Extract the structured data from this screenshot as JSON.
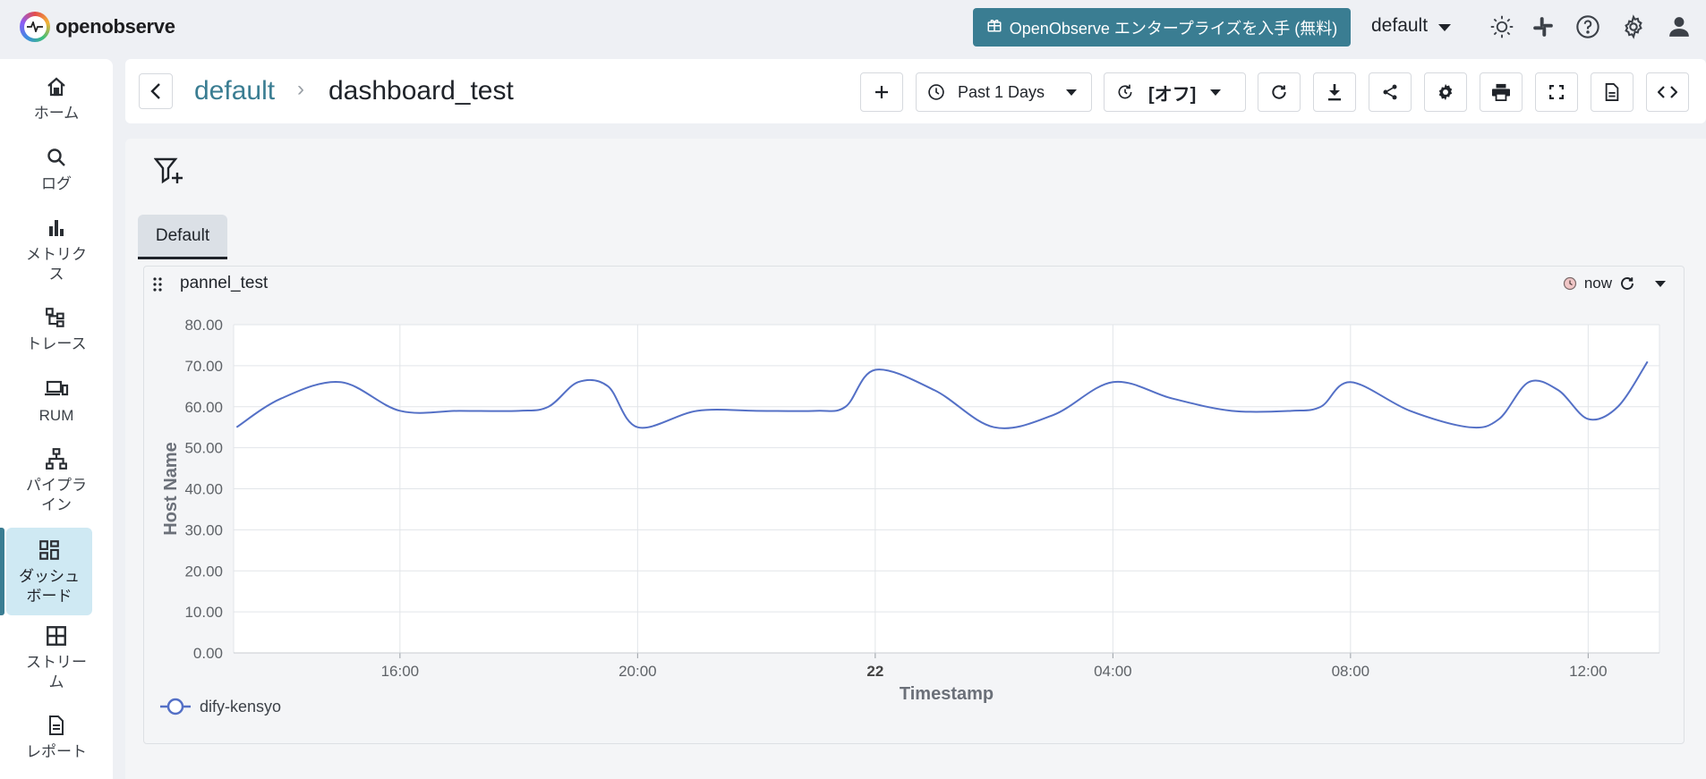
{
  "app": {
    "logo_text": "openobserve",
    "enterprise_button": "OpenObserve エンタープライズを入手 (無料)",
    "org_selected": "default"
  },
  "sidebar": {
    "items": [
      {
        "label": "ホーム",
        "icon": "home-icon"
      },
      {
        "label": "ログ",
        "icon": "search-icon"
      },
      {
        "label": "メトリクス",
        "icon": "bar-chart-icon"
      },
      {
        "label": "トレース",
        "icon": "trace-icon"
      },
      {
        "label": "RUM",
        "icon": "devices-icon"
      },
      {
        "label": "パイプライン",
        "icon": "pipeline-icon"
      },
      {
        "label": "ダッシュボード",
        "icon": "dashboard-icon",
        "active": true
      },
      {
        "label": "ストリーム",
        "icon": "grid-icon"
      },
      {
        "label": "レポート",
        "icon": "report-icon"
      }
    ]
  },
  "header": {
    "breadcrumb_root": "default",
    "breadcrumb_sep": "›",
    "title": "dashboard_test",
    "time_range": "Past 1 Days",
    "refresh_interval": "[オフ]"
  },
  "content": {
    "tab_label": "Default",
    "panel": {
      "title": "pannel_test",
      "time_label": "now"
    }
  },
  "colors": {
    "accent": "#3a7d92",
    "series": "#5470c6",
    "active_nav_bg": "#cfe9f3"
  },
  "chart_data": {
    "type": "line",
    "title": "pannel_test",
    "xlabel": "Timestamp",
    "ylabel": "Host Name",
    "ylim": [
      0,
      80
    ],
    "yticks": [
      "80.00",
      "70.00",
      "60.00",
      "50.00",
      "40.00",
      "30.00",
      "20.00",
      "10.00",
      "0.00"
    ],
    "xticks": [
      "16:00",
      "20:00",
      "22",
      "04:00",
      "08:00",
      "12:00"
    ],
    "xtick_hours": [
      16,
      20,
      24,
      28,
      32,
      36
    ],
    "xlim_hours": [
      13.2,
      37.2
    ],
    "grid": true,
    "legend_position": "bottom-left",
    "series": [
      {
        "name": "dify-kensyo",
        "x_hours": [
          13.25,
          14.0,
          15.0,
          16.0,
          17.0,
          18.0,
          18.5,
          19.0,
          19.5,
          20.0,
          21.0,
          22.0,
          23.0,
          23.5,
          24.0,
          25.0,
          26.0,
          27.0,
          28.0,
          29.0,
          30.0,
          31.0,
          31.5,
          32.0,
          33.0,
          34.0,
          34.5,
          35.0,
          35.5,
          36.0,
          36.5,
          37.0
        ],
        "values": [
          55,
          62,
          66,
          59,
          59,
          59,
          60,
          66,
          65,
          55,
          59,
          59,
          59,
          60,
          69,
          64,
          55,
          58,
          66,
          62,
          59,
          59,
          60,
          66,
          59,
          55,
          57,
          66,
          64,
          57,
          60,
          71
        ]
      }
    ]
  }
}
